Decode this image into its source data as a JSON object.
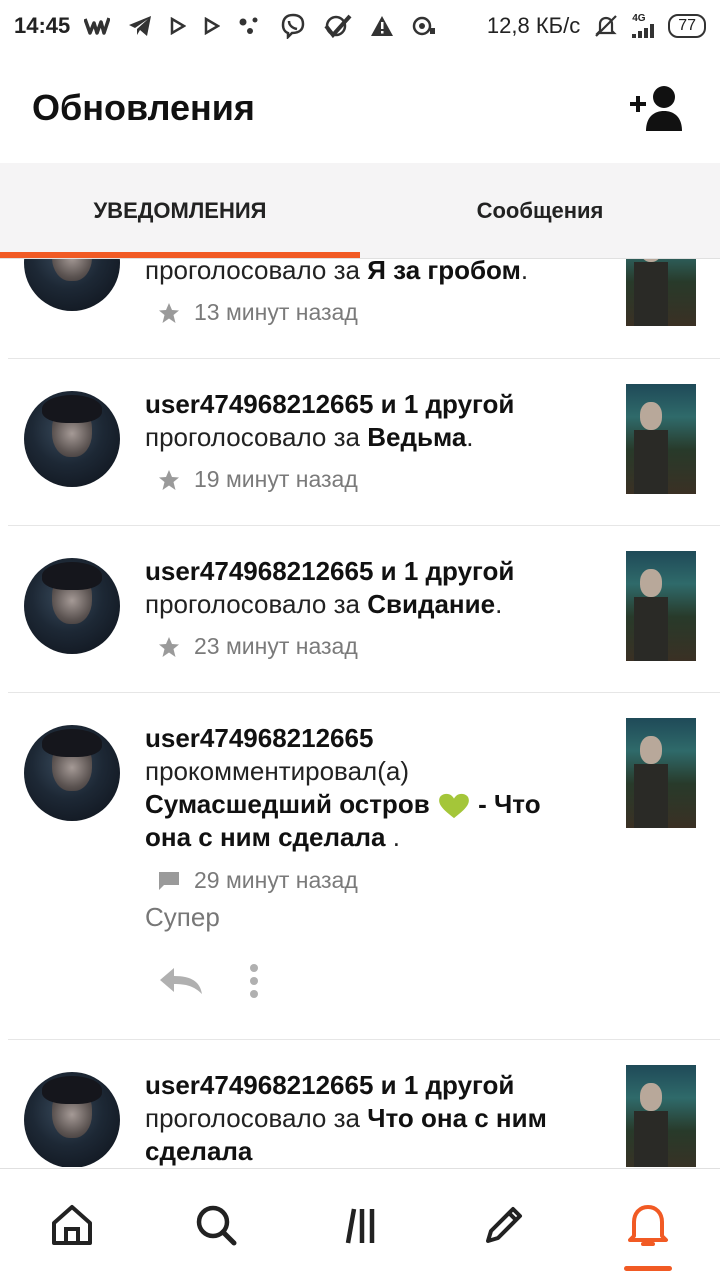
{
  "statusbar": {
    "time": "14:45",
    "speed": "12,8 КБ/с",
    "network": "4G",
    "battery": "77",
    "icons": [
      "wattpad-icon",
      "telegram-icon",
      "play-icon",
      "play-icon",
      "dots-icon",
      "viber-icon",
      "check-icon",
      "warning-icon",
      "vpn-icon"
    ]
  },
  "header": {
    "title": "Обновления",
    "action_icon": "add-friend-icon"
  },
  "tabs": [
    {
      "label": "УВЕДОМЛЕНИЯ",
      "active": true
    },
    {
      "label": "Сообщения",
      "active": false
    }
  ],
  "feed": [
    {
      "user": "",
      "action": "проголосовало за",
      "story": "Я за гробом",
      "suffix": ".",
      "time": "13 минут назад",
      "type": "vote"
    },
    {
      "user": "user474968212665 и 1 другой",
      "action": "проголосовало за",
      "story": "Ведьма",
      "suffix": ".",
      "time": "19 минут назад",
      "type": "vote"
    },
    {
      "user": "user474968212665 и 1 другой",
      "action": "проголосовало за",
      "story": "Свидание",
      "suffix": ".",
      "time": "23 минут назад",
      "type": "vote"
    },
    {
      "user": "user474968212665",
      "action": "прокомментировал(а)",
      "story_part1": "Сумасшедший остров",
      "story_part2": "- Что она с ним сделала",
      "suffix": ".",
      "time": "29 минут назад",
      "comment": "Супер",
      "type": "comment"
    },
    {
      "user": "user474968212665 и 1 другой",
      "action": "проголосовало за",
      "story": "Что она с ним сделала",
      "suffix": "",
      "time": "",
      "type": "vote"
    }
  ],
  "bottom_nav": [
    {
      "icon": "home-icon",
      "active": false
    },
    {
      "icon": "search-icon",
      "active": false
    },
    {
      "icon": "library-icon",
      "active": false
    },
    {
      "icon": "write-icon",
      "active": false
    },
    {
      "icon": "notifications-icon",
      "active": true
    }
  ],
  "colors": {
    "accent": "#f15a24",
    "heart": "#a4c639"
  }
}
